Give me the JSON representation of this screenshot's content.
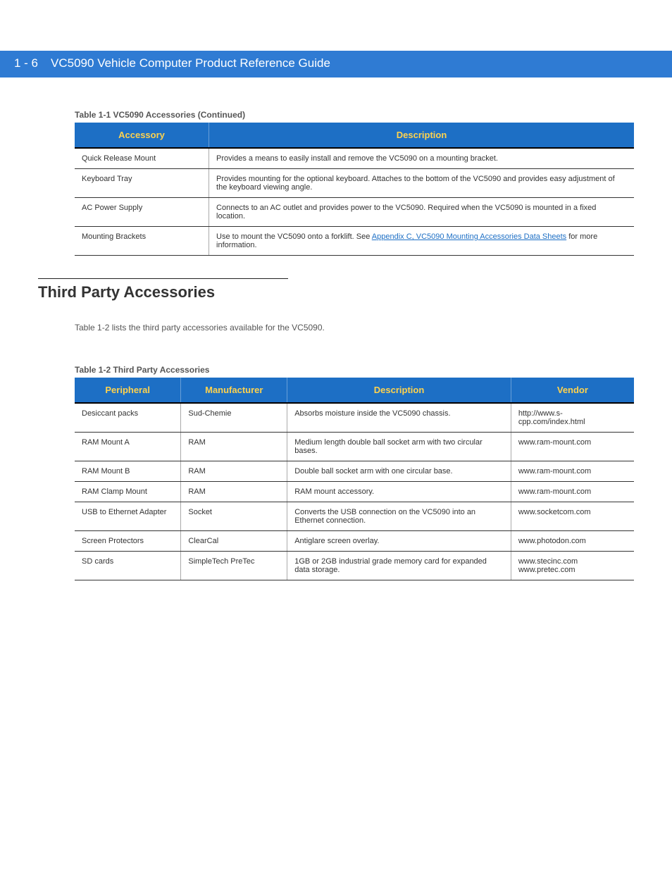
{
  "header": {
    "page_num": "1 - 6",
    "doc_title": "VC5090 Vehicle Computer Product Reference Guide"
  },
  "table1": {
    "caption": "Table 1-1  VC5090 Accessories (Continued)",
    "head": {
      "c0": "Accessory",
      "c1": "Description"
    },
    "rows": [
      {
        "c0": "Quick Release Mount",
        "c1": "Provides a means to easily install and remove the VC5090 on a mounting bracket."
      },
      {
        "c0": "Keyboard Tray",
        "c1": "Provides mounting for the optional keyboard. Attaches to the bottom of the VC5090 and provides easy adjustment of the keyboard viewing angle."
      },
      {
        "c0": "AC Power Supply",
        "c1": "Connects to an AC outlet and provides power to the VC5090. Required when the VC5090 is mounted in a fixed location."
      },
      {
        "c0": "Mounting Brackets",
        "c1_pre": "Use to mount the VC5090 onto a forklift. See ",
        "c1_link": "Appendix C, VC5090 Mounting Accessories Data Sheets",
        "c1_post": " for more information."
      }
    ]
  },
  "section_heading": "Third Party Accessories",
  "note": "Table 1-2 lists the third party accessories available for the VC5090.",
  "table2": {
    "caption": "Table 1-2  Third Party Accessories",
    "head": {
      "c0": "Peripheral",
      "c1": "Manufacturer",
      "c2": "Description",
      "c3": "Vendor"
    },
    "rows": [
      {
        "c0": "Desiccant packs",
        "c1": "Sud-Chemie",
        "c2": "Absorbs moisture inside the VC5090 chassis.",
        "c3": "http://www.s-cpp.com/index.html"
      },
      {
        "c0": "RAM Mount A",
        "c1": "RAM",
        "c2": "Medium length double ball socket arm with two circular bases.",
        "c3": "www.ram-mount.com"
      },
      {
        "c0": "RAM Mount B",
        "c1": "RAM",
        "c2": "Double ball socket arm with one circular base.",
        "c3": "www.ram-mount.com"
      },
      {
        "c0": "RAM Clamp Mount",
        "c1": "RAM",
        "c2": "RAM mount accessory.",
        "c3": "www.ram-mount.com"
      },
      {
        "c0": "USB to Ethernet Adapter",
        "c1": "Socket",
        "c2": "Converts the USB connection on the VC5090 into an Ethernet connection.",
        "c3": "www.socketcom.com"
      },
      {
        "c0": "Screen Protectors",
        "c1": "ClearCal",
        "c2": "Antiglare screen overlay.",
        "c3": "www.photodon.com"
      },
      {
        "c0": "SD cards",
        "c1": "SimpleTech PreTec",
        "c2": "1GB or 2GB industrial grade memory card for expanded data storage.",
        "c3": "www.stecinc.com www.pretec.com"
      }
    ]
  }
}
